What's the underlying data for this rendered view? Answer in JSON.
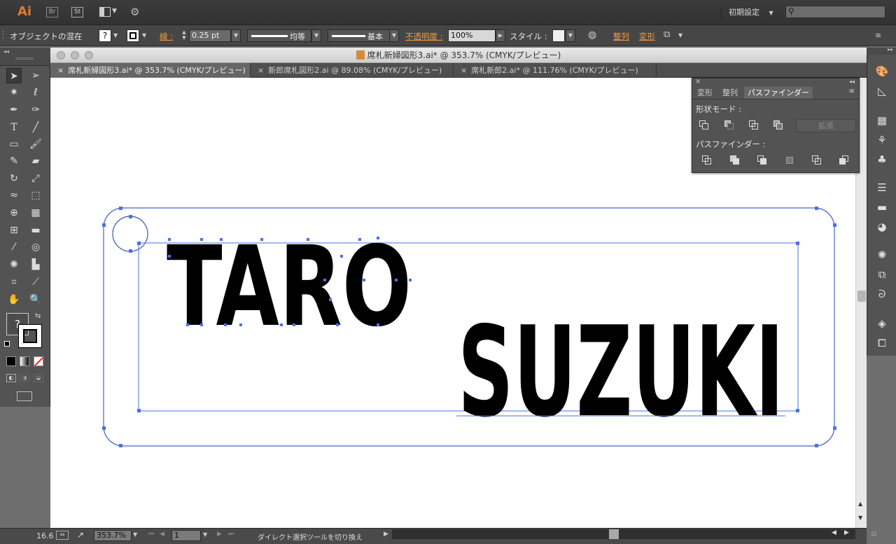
{
  "app": {
    "logo": "Ai",
    "bridge_label": "Br",
    "stock_label": "St",
    "workspace": "初期設定",
    "search_placeholder": ""
  },
  "control": {
    "mode_label": "オブジェクトの混在",
    "stroke_label": "線 :",
    "stroke_value": "0.25 pt",
    "profile_label": "均等",
    "brush_label": "基本",
    "opacity_label": "不透明度 :",
    "opacity_value": "100%",
    "style_label": "スタイル :",
    "align_label": "整列",
    "transform_label": "変形"
  },
  "document": {
    "window_title": "席札新婦図形3.ai* @ 353.7% (CMYK/プレビュー)",
    "tabs": [
      {
        "label": "席札新婦図形3.ai* @ 353.7% (CMYK/プレビュー)",
        "active": true
      },
      {
        "label": "新郎席札図形2.ai @ 89.08% (CMYK/プレビュー)",
        "active": false
      },
      {
        "label": "席札新郎2.ai* @ 111.76% (CMYK/プレビュー)",
        "active": false
      }
    ]
  },
  "artwork": {
    "line1": "TARO",
    "line2": "SUZUKI",
    "selection_color": "#4a72e6"
  },
  "pathfinder_panel": {
    "tabs": [
      "変形",
      "整列",
      "パスファインダー"
    ],
    "active_tab": "パスファインダー",
    "shape_modes_label": "形状モード :",
    "expand_button": "拡張",
    "pathfinders_label": "パスファインダー :"
  },
  "tools": {
    "help_glyph": "?"
  },
  "status": {
    "left_value": "16.6",
    "zoom": "353.7%",
    "artboard": "1",
    "tool_status": "ダイレクト選択ツールを切り換え"
  }
}
